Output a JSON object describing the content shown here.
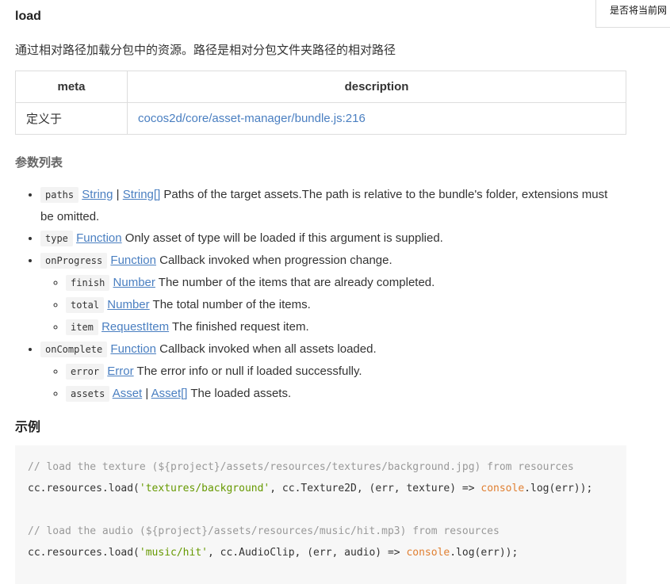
{
  "title": "load",
  "description": "通过相对路径加载分包中的资源。路径是相对分包文件夹路径的相对路径",
  "meta_table": {
    "headers": [
      "meta",
      "description"
    ],
    "row_label": "定义于",
    "row_link": "cocos2d/core/asset-manager/bundle.js:216"
  },
  "params_heading": "参数列表",
  "params": {
    "paths": {
      "name": "paths",
      "type1": "String",
      "sep": " | ",
      "type2": "String[]",
      "desc": " Paths of the target assets.The path is relative to the bundle's folder, extensions must be omitted."
    },
    "type": {
      "name": "type",
      "type1": "Function",
      "desc": " Only asset of type will be loaded if this argument is supplied."
    },
    "onProgress": {
      "name": "onProgress",
      "type1": "Function",
      "desc": " Callback invoked when progression change."
    },
    "finish": {
      "name": "finish",
      "type1": "Number",
      "desc": " The number of the items that are already completed."
    },
    "total": {
      "name": "total",
      "type1": "Number",
      "desc": " The total number of the items."
    },
    "item": {
      "name": "item",
      "type1": "RequestItem",
      "desc": " The finished request item."
    },
    "onComplete": {
      "name": "onComplete",
      "type1": "Function",
      "desc": " Callback invoked when all assets loaded."
    },
    "error": {
      "name": "error",
      "type1": "Error",
      "desc": " The error info or null if loaded successfully."
    },
    "assets": {
      "name": "assets",
      "type1": "Asset",
      "sep": " | ",
      "type2": "Asset[]",
      "desc": " The loaded assets."
    }
  },
  "example_heading": "示例",
  "code": {
    "c1": "// load the texture (${project}/assets/resources/textures/background.jpg) from resources",
    "l1a": "cc.resources.load(",
    "l1s": "'textures/background'",
    "l1b": ", cc.Texture2D, (err, texture) => ",
    "l1k": "console",
    "l1c": ".log(err));",
    "c2": "// load the audio (${project}/assets/resources/music/hit.mp3) from resources",
    "l2a": "cc.resources.load(",
    "l2s": "'music/hit'",
    "l2b": ", cc.AudioClip, (err, audio) => ",
    "l2k": "console",
    "l2c": ".log(err));"
  },
  "tooltip": "是否将当前网"
}
